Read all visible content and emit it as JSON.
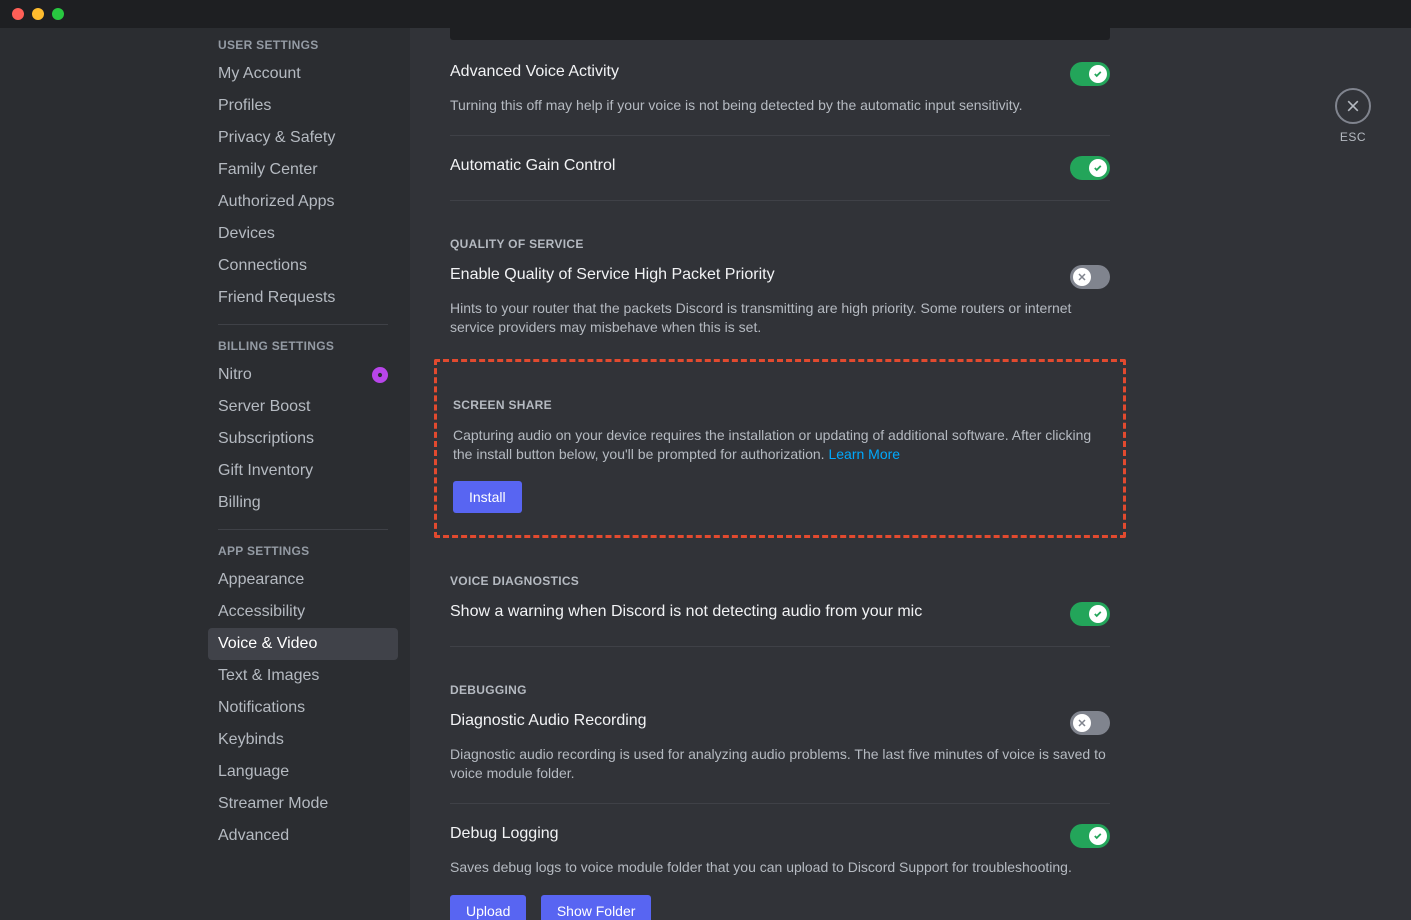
{
  "window": {
    "esc_label": "ESC"
  },
  "sidebar": {
    "sections": [
      {
        "header": "User Settings",
        "items": [
          {
            "label": "My Account"
          },
          {
            "label": "Profiles"
          },
          {
            "label": "Privacy & Safety"
          },
          {
            "label": "Family Center"
          },
          {
            "label": "Authorized Apps"
          },
          {
            "label": "Devices"
          },
          {
            "label": "Connections"
          },
          {
            "label": "Friend Requests"
          }
        ]
      },
      {
        "header": "Billing Settings",
        "items": [
          {
            "label": "Nitro",
            "badge": true
          },
          {
            "label": "Server Boost"
          },
          {
            "label": "Subscriptions"
          },
          {
            "label": "Gift Inventory"
          },
          {
            "label": "Billing"
          }
        ]
      },
      {
        "header": "App Settings",
        "items": [
          {
            "label": "Appearance"
          },
          {
            "label": "Accessibility"
          },
          {
            "label": "Voice & Video",
            "active": true
          },
          {
            "label": "Text & Images"
          },
          {
            "label": "Notifications"
          },
          {
            "label": "Keybinds"
          },
          {
            "label": "Language"
          },
          {
            "label": "Streamer Mode"
          },
          {
            "label": "Advanced"
          }
        ]
      }
    ]
  },
  "content": {
    "ava": {
      "title": "Advanced Voice Activity",
      "desc": "Turning this off may help if your voice is not being detected by the automatic input sensitivity.",
      "enabled": true
    },
    "agc": {
      "title": "Automatic Gain Control",
      "enabled": true
    },
    "qos_header": "Quality of Service",
    "qos": {
      "title": "Enable Quality of Service High Packet Priority",
      "desc": "Hints to your router that the packets Discord is transmitting are high priority. Some routers or internet service providers may misbehave when this is set.",
      "enabled": false
    },
    "screen_share": {
      "header": "Screen Share",
      "desc": "Capturing audio on your device requires the installation or updating of additional software. After clicking the install button below, you'll be prompted for authorization. ",
      "learn_more": "Learn More",
      "install_label": "Install"
    },
    "voice_diag_header": "Voice Diagnostics",
    "voice_diag": {
      "title": "Show a warning when Discord is not detecting audio from your mic",
      "enabled": true
    },
    "debug_header": "Debugging",
    "diag_record": {
      "title": "Diagnostic Audio Recording",
      "desc": "Diagnostic audio recording is used for analyzing audio problems. The last five minutes of voice is saved to voice module folder.",
      "enabled": false
    },
    "debug_log": {
      "title": "Debug Logging",
      "desc": "Saves debug logs to voice module folder that you can upload to Discord Support for troubleshooting.",
      "enabled": true,
      "upload_label": "Upload",
      "show_folder_label": "Show Folder"
    }
  }
}
